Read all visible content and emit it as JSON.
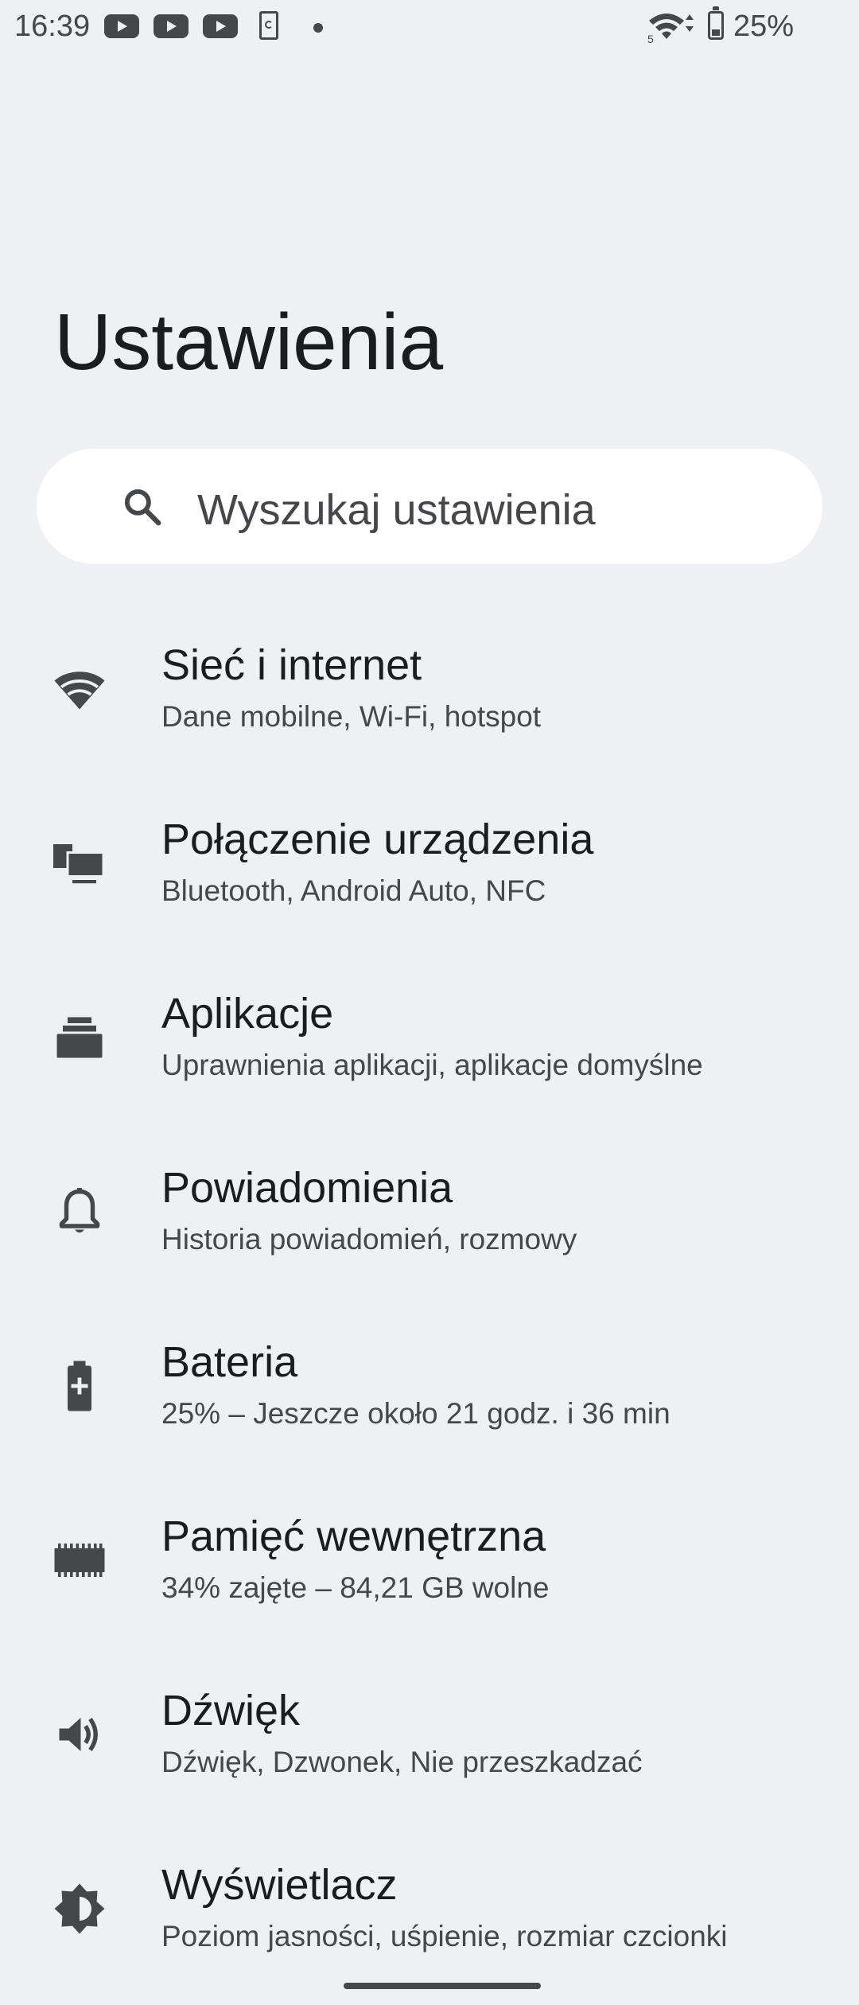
{
  "status_bar": {
    "time": "16:39",
    "battery_percent": "25%",
    "notification_icons": [
      "youtube-icon",
      "youtube-icon",
      "youtube-icon",
      "sim-icon",
      "dot-icon"
    ],
    "wifi_badge": "5"
  },
  "page": {
    "title": "Ustawienia"
  },
  "search": {
    "placeholder": "Wyszukaj ustawienia",
    "icon": "search-icon"
  },
  "settings": {
    "items": [
      {
        "id": "network",
        "icon": "wifi-icon",
        "title": "Sieć i internet",
        "subtitle": "Dane mobilne, Wi-Fi, hotspot"
      },
      {
        "id": "connected-devices",
        "icon": "devices-icon",
        "title": "Połączenie urządzenia",
        "subtitle": "Bluetooth, Android Auto, NFC"
      },
      {
        "id": "apps",
        "icon": "apps-icon",
        "title": "Aplikacje",
        "subtitle": "Uprawnienia aplikacji, aplikacje domyślne"
      },
      {
        "id": "notifications",
        "icon": "bell-icon",
        "title": "Powiadomienia",
        "subtitle": "Historia powiadomień, rozmowy"
      },
      {
        "id": "battery",
        "icon": "battery-icon",
        "title": "Bateria",
        "subtitle": "25% – Jeszcze około 21 godz. i 36 min"
      },
      {
        "id": "storage",
        "icon": "storage-icon",
        "title": "Pamięć wewnętrzna",
        "subtitle": "34% zajęte – 84,21 GB wolne"
      },
      {
        "id": "sound",
        "icon": "speaker-icon",
        "title": "Dźwięk",
        "subtitle": "Dźwięk, Dzwonek, Nie przeszkadzać"
      },
      {
        "id": "display",
        "icon": "brightness-icon",
        "title": "Wyświetlacz",
        "subtitle": "Poziom jasności, uśpienie, rozmiar czcionki"
      }
    ]
  },
  "colors": {
    "background": "#eff0f4",
    "surface": "#ffffff",
    "icon": "#46474b",
    "text_primary": "#1b1c1f",
    "text_secondary": "#46474b"
  }
}
